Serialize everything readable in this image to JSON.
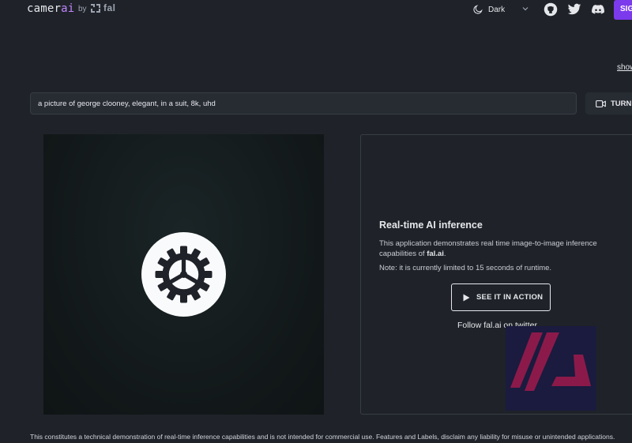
{
  "header": {
    "logo_main": "camer",
    "logo_accent": "ai",
    "by_label": "by",
    "fal_label": "fal",
    "theme_label": "Dark",
    "signin_label": "SIG"
  },
  "icons": {
    "moon": "moon-icon",
    "chevron": "chevron-down-icon",
    "github": "github-icon",
    "twitter": "twitter-icon",
    "discord": "discord-icon",
    "camera": "video-camera-icon",
    "play": "play-icon",
    "settings": "gear-icon"
  },
  "show_link": "show",
  "prompt": {
    "value": "a picture of george clooney, elegant, in a suit, 8k, uhd"
  },
  "turn_button_label": "TURN",
  "info": {
    "title": "Real-time AI inference",
    "desc_prefix": "This application demonstrates real time image-to-image inference capabilities of ",
    "desc_brand": "fal.ai",
    "desc_suffix": ".",
    "note": "Note: it is currently limited to 15 seconds of runtime.",
    "action_label": "SEE IT IN ACTION",
    "follow_text": "Follow fal.ai on twitter"
  },
  "footer": {
    "disclaimer": "This constitutes a technical demonstration of real-time inference capabilities and is not intended for commercial use. Features and Labels, disclaim any liability for misuse or unintended applications."
  },
  "colors": {
    "background": "#1f2329",
    "accent_purple": "#7c3aed",
    "logo_accent": "#c084fc",
    "fal_logo_bg": "#1a1b3e",
    "fal_logo_mark": "#8b1a4a"
  }
}
